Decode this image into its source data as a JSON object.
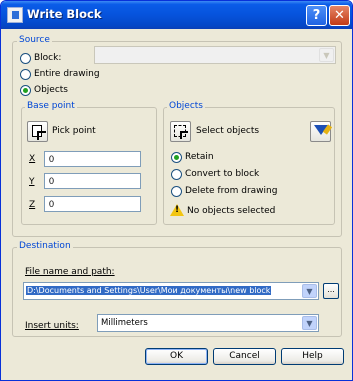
{
  "window": {
    "title": "Write Block"
  },
  "titlebar": {
    "help_label": "?",
    "close_label": "✕"
  },
  "source": {
    "title": "Source",
    "options": [
      {
        "label": "Block:",
        "selected": false
      },
      {
        "label": "Entire drawing",
        "selected": false
      },
      {
        "label": "Objects",
        "selected": true
      }
    ],
    "block_select_value": ""
  },
  "base_point": {
    "title": "Base point",
    "pick_label": "Pick point",
    "x_label": "X",
    "x_value": "0",
    "y_label": "Y",
    "y_value": "0",
    "z_label": "Z",
    "z_value": "0"
  },
  "objects": {
    "title": "Objects",
    "select_label": "Select objects",
    "options": [
      {
        "label": "Retain",
        "selected": true
      },
      {
        "label": "Convert to block",
        "selected": false
      },
      {
        "label": "Delete from drawing",
        "selected": false
      }
    ],
    "status": "No objects selected"
  },
  "destination": {
    "title": "Destination",
    "path_label": "File name and path:",
    "path_value": "D:\\Documents and Settings\\User\\Мои документы\\new block",
    "browse_label": "...",
    "units_label": "Insert units:",
    "units_value": "Millimeters"
  },
  "buttons": {
    "ok": "OK",
    "cancel": "Cancel",
    "help": "Help"
  },
  "colors": {
    "group_title": "#0046d5",
    "title_bar": "#0653dc",
    "dialog_bg": "#ece9d8"
  }
}
